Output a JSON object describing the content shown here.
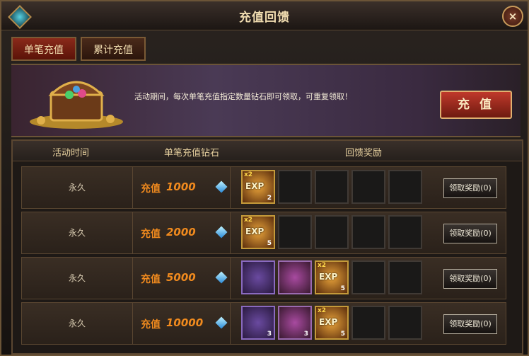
{
  "window": {
    "title": "充值回馈",
    "close_label": "×"
  },
  "tabs": [
    {
      "label": "单笔充值",
      "active": true
    },
    {
      "label": "累计充值",
      "active": false
    }
  ],
  "banner": {
    "text": "活动期间，每次单笔充值指定数量钻石即可领取，可重复领取！",
    "button_label": "充 值"
  },
  "table": {
    "headers": [
      "活动时间",
      "单笔充值钻石",
      "回馈奖励"
    ],
    "rows": [
      {
        "time": "永久",
        "amount_label": "充值",
        "amount": "1000",
        "rewards": [
          {
            "type": "exp",
            "multiplier": "x2",
            "text": "EXP",
            "qty": "2"
          }
        ],
        "claim_label": "领取奖励(0)"
      },
      {
        "time": "永久",
        "amount_label": "充值",
        "amount": "2000",
        "rewards": [
          {
            "type": "exp",
            "multiplier": "x2",
            "text": "EXP",
            "qty": "5"
          }
        ],
        "claim_label": "领取奖励(0)"
      },
      {
        "time": "永久",
        "amount_label": "充值",
        "amount": "5000",
        "rewards": [
          {
            "type": "horn",
            "qty": ""
          },
          {
            "type": "gem",
            "qty": ""
          },
          {
            "type": "exp",
            "multiplier": "x2",
            "text": "EXP",
            "qty": "5"
          }
        ],
        "claim_label": "领取奖励(0)"
      },
      {
        "time": "永久",
        "amount_label": "充值",
        "amount": "10000",
        "rewards": [
          {
            "type": "horn",
            "qty": "3"
          },
          {
            "type": "gem",
            "qty": "3"
          },
          {
            "type": "exp",
            "multiplier": "x2",
            "text": "EXP",
            "qty": "5"
          }
        ],
        "claim_label": "领取奖励(0)"
      }
    ]
  },
  "colors": {
    "accent": "#f08a1e",
    "frame": "#6b5437",
    "button_red": "#c0392b"
  }
}
